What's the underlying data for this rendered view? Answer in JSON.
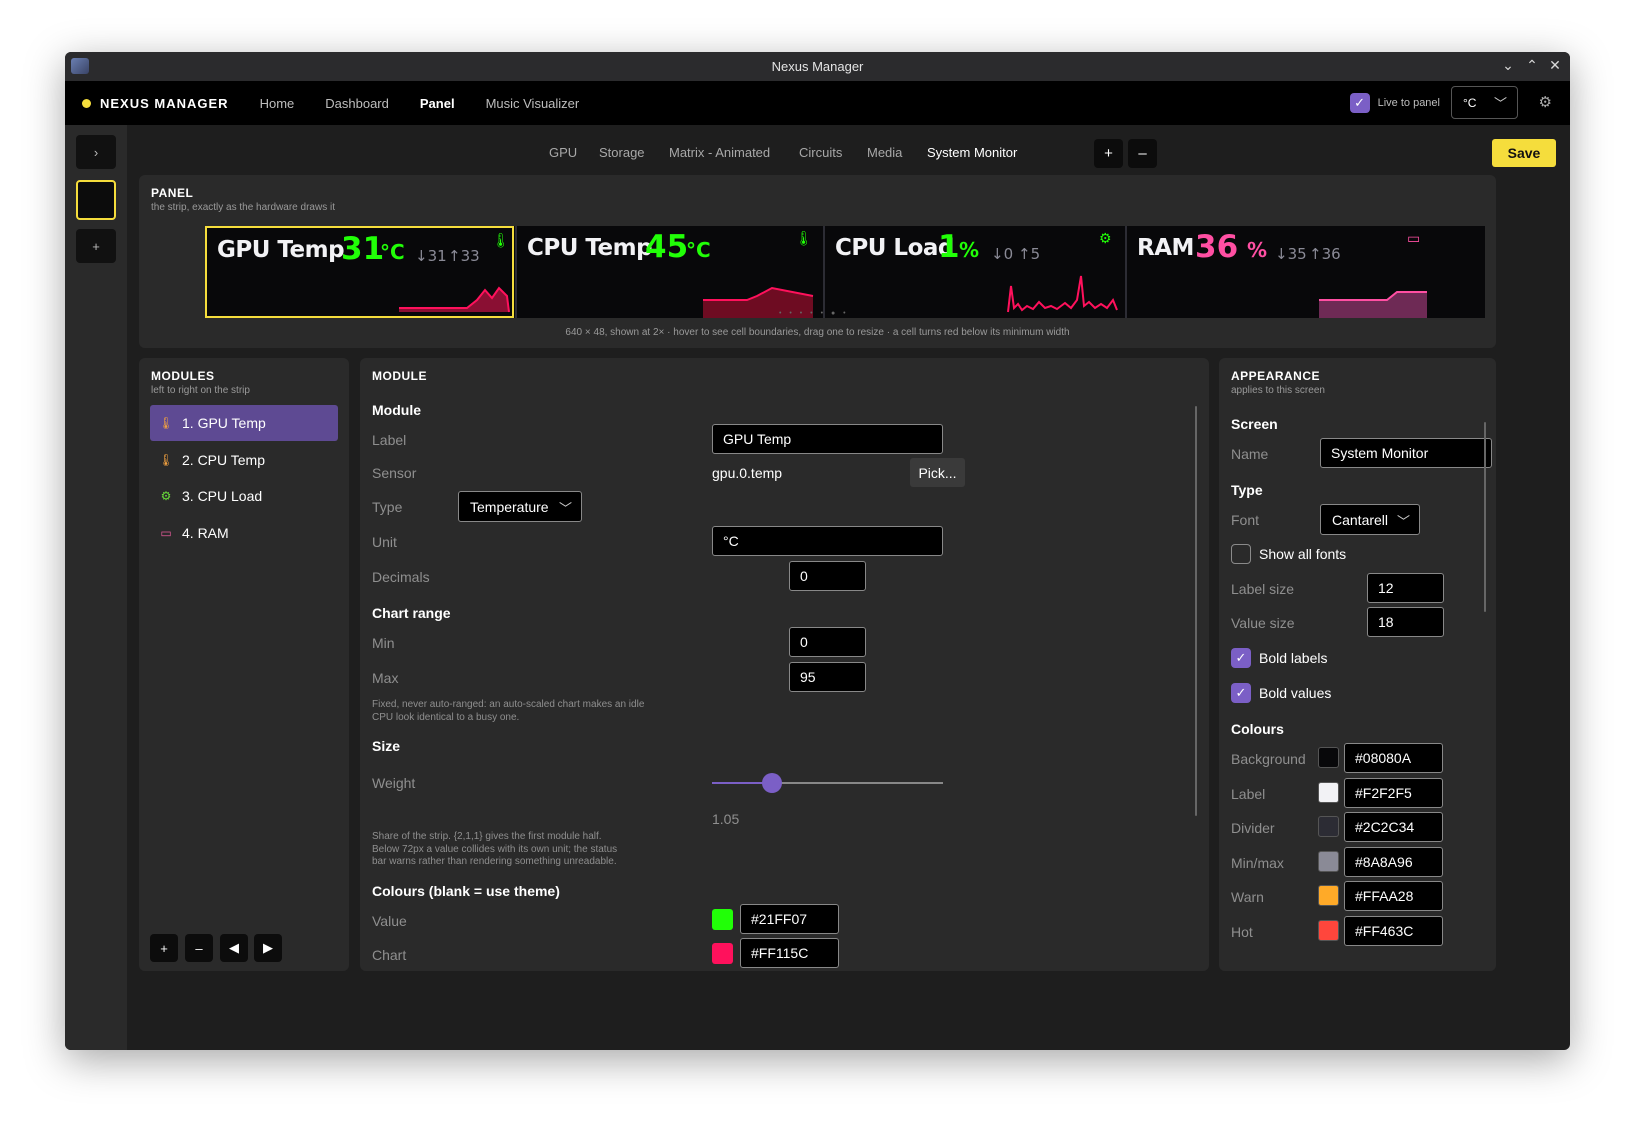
{
  "window": {
    "title": "Nexus Manager"
  },
  "nav": {
    "brand": "NEXUS MANAGER",
    "items": [
      "Home",
      "Dashboard",
      "Panel",
      "Music Visualizer"
    ],
    "active": "Panel",
    "live_label": "Live to panel",
    "live_checked": true,
    "unit_value": "°C"
  },
  "tabs": {
    "items": [
      "GPU",
      "Storage",
      "Matrix - Animated",
      "Circuits",
      "Media",
      "System Monitor"
    ],
    "active": "System Monitor",
    "add_label": "+",
    "remove_label": "–",
    "save_label": "Save"
  },
  "panel": {
    "heading": "PANEL",
    "subtitle": "the strip, exactly as the hardware draws it",
    "note": "640 × 48, shown at 2× · hover to see cell boundaries, drag one to resize · a cell turns red below its minimum width",
    "cells": [
      {
        "label": "GPU Temp",
        "value": "31",
        "unit": "°C",
        "min": "↓31",
        "max": "↑33",
        "value_color": "#21FF07",
        "icon": "thermometer-icon"
      },
      {
        "label": "CPU Temp",
        "value": "45",
        "unit": "°C",
        "min": "",
        "max": "",
        "value_color": "#21FF07",
        "icon": "thermometer-icon"
      },
      {
        "label": "CPU Load",
        "value": "1",
        "unit": "%",
        "min": "↓0",
        "max": "↑5",
        "value_color": "#21FF07",
        "icon": "chip-icon"
      },
      {
        "label": "RAM",
        "value": "36",
        "unit": "%",
        "min": "↓35",
        "max": "↑36",
        "value_color": "#FF4FA3",
        "icon": "memory-icon"
      }
    ]
  },
  "modules": {
    "heading": "MODULES",
    "subtitle": "left to right on the strip",
    "items": [
      {
        "label": "1. GPU Temp",
        "icon": "thermometer-icon"
      },
      {
        "label": "2. CPU Temp",
        "icon": "thermometer-icon"
      },
      {
        "label": "3. CPU Load",
        "icon": "chip-icon"
      },
      {
        "label": "4. RAM",
        "icon": "memory-icon"
      }
    ],
    "buttons": {
      "add": "+",
      "remove": "–",
      "left": "◀",
      "right": "▶"
    }
  },
  "module": {
    "heading": "MODULE",
    "section_module": "Module",
    "label_label": "Label",
    "label_value": "GPU Temp",
    "sensor_label": "Sensor",
    "sensor_value": "gpu.0.temp",
    "pick_label": "Pick...",
    "type_label": "Type",
    "type_value": "Temperature",
    "unit_label": "Unit",
    "unit_value": "°C",
    "decimals_label": "Decimals",
    "decimals_value": "0",
    "section_range": "Chart range",
    "min_label": "Min",
    "min_value": "0",
    "max_label": "Max",
    "max_value": "95",
    "range_help_1": "Fixed, never auto-ranged: an auto-scaled chart makes an idle",
    "range_help_2": "CPU look identical to a busy one.",
    "section_size": "Size",
    "weight_label": "Weight",
    "weight_value": "1.05",
    "weight_fraction": 0.26,
    "size_help_1": "Share of the strip. {2,1,1} gives the first module half.",
    "size_help_2": "Below 72px a value collides with its own unit; the status",
    "size_help_3": "bar warns rather than rendering something unreadable.",
    "section_colours": "Colours (blank = use theme)",
    "value_label": "Value",
    "value_color": "#21FF07",
    "chart_label": "Chart",
    "chart_color": "#FF115C"
  },
  "appearance": {
    "heading": "APPEARANCE",
    "subtitle": "applies to this screen",
    "section_screen": "Screen",
    "name_label": "Name",
    "name_value": "System Monitor",
    "section_type": "Type",
    "font_label": "Font",
    "font_value": "Cantarell",
    "show_all_fonts": "Show all fonts",
    "label_size_label": "Label size",
    "label_size_value": "12",
    "value_size_label": "Value size",
    "value_size_value": "18",
    "bold_labels": "Bold labels",
    "bold_values": "Bold values",
    "section_colours": "Colours",
    "colours": [
      {
        "name": "Background",
        "hex": "#08080A"
      },
      {
        "name": "Label",
        "hex": "#F2F2F5"
      },
      {
        "name": "Divider",
        "hex": "#2C2C34"
      },
      {
        "name": "Min/max",
        "hex": "#8A8A96"
      },
      {
        "name": "Warn",
        "hex": "#FFAA28"
      },
      {
        "name": "Hot",
        "hex": "#FF463C"
      }
    ]
  }
}
